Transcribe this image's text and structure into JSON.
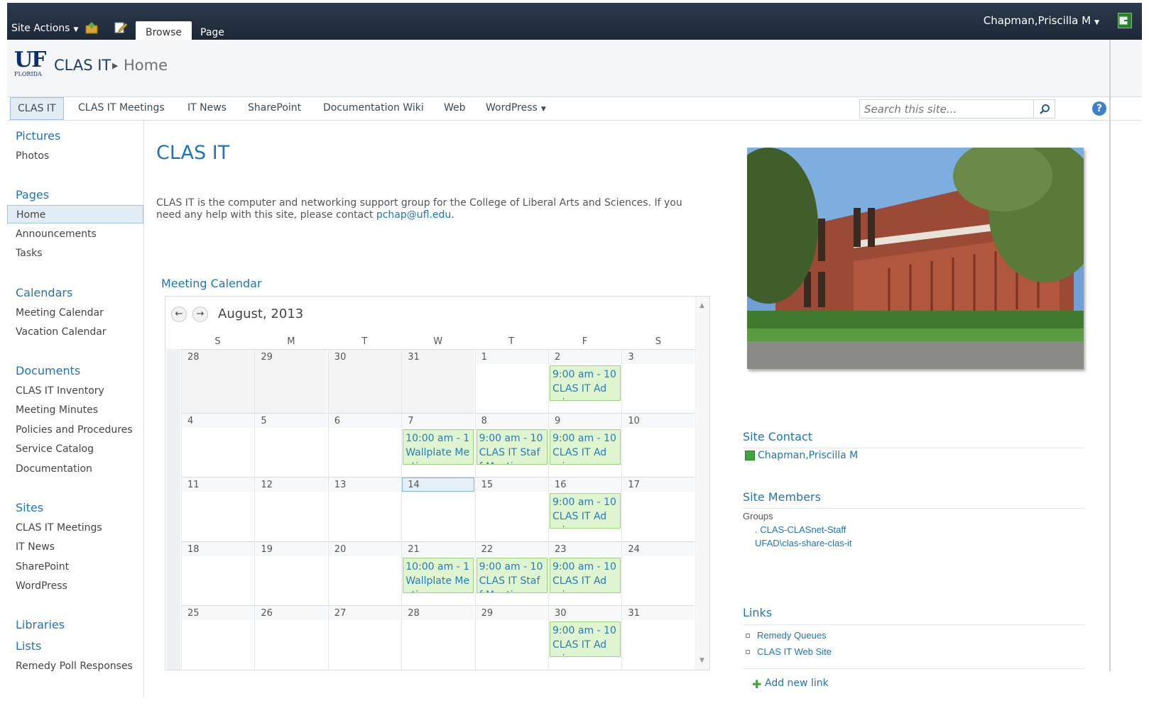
{
  "ribbon": {
    "site_actions": "Site Actions",
    "tabs": [
      "Browse",
      "Page"
    ],
    "user": "Chapman,Priscilla M"
  },
  "title": {
    "logo_top": "UF",
    "logo_sub": "FLORIDA",
    "site": "CLAS IT",
    "page": "Home"
  },
  "topnav": {
    "items": [
      "CLAS IT",
      "CLAS IT Meetings",
      "IT News",
      "SharePoint",
      "Documentation Wiki",
      "Web",
      "WordPress"
    ],
    "search_placeholder": "Search this site...",
    "help": "?"
  },
  "leftnav": {
    "pictures": "Pictures",
    "photos": "Photos",
    "pages": "Pages",
    "pages_items": [
      "Home",
      "Announcements",
      "Tasks"
    ],
    "calendars": "Calendars",
    "calendar_items": [
      "Meeting Calendar",
      "Vacation Calendar"
    ],
    "documents": "Documents",
    "document_items": [
      "CLAS IT Inventory",
      "Meeting Minutes",
      "Policies and Procedures",
      "Service Catalog",
      "Documentation"
    ],
    "sites": "Sites",
    "site_items": [
      "CLAS IT Meetings",
      "IT News",
      "SharePoint",
      "WordPress"
    ],
    "libraries": "Libraries",
    "lists": "Lists",
    "remedy": "Remedy Poll Responses"
  },
  "main": {
    "title": "CLAS IT",
    "intro": "CLAS IT is the computer and networking support group for the College of Liberal Arts and Sciences. If you need any help with this site, please contact ",
    "email": "pchap@ufl.edu",
    "intro_end": "."
  },
  "calendar": {
    "title": "Meeting Calendar",
    "month": "August, 2013",
    "days_of_week": [
      "S",
      "M",
      "T",
      "W",
      "T",
      "F",
      "S"
    ],
    "weeks": [
      [
        {
          "d": "28",
          "other": true
        },
        {
          "d": "29",
          "other": true
        },
        {
          "d": "30",
          "other": true
        },
        {
          "d": "31",
          "other": true
        },
        {
          "d": "1"
        },
        {
          "d": "2",
          "ev": {
            "t": "9:00 am - 10",
            "n": "CLAS IT Ad",
            "n2": "mins"
          }
        },
        {
          "d": "3"
        }
      ],
      [
        {
          "d": "4"
        },
        {
          "d": "5"
        },
        {
          "d": "6"
        },
        {
          "d": "7",
          "ev": {
            "t": "10:00 am - 1",
            "n": "Wallplate Me",
            "n2": "eting"
          }
        },
        {
          "d": "8",
          "ev": {
            "t": "9:00 am - 10",
            "n": "CLAS IT Staf",
            "n2": "f Meeting"
          }
        },
        {
          "d": "9",
          "ev": {
            "t": "9:00 am - 10",
            "n": "CLAS IT Ad",
            "n2": "mins"
          }
        },
        {
          "d": "10"
        }
      ],
      [
        {
          "d": "11"
        },
        {
          "d": "12"
        },
        {
          "d": "13"
        },
        {
          "d": "14",
          "today": true
        },
        {
          "d": "15"
        },
        {
          "d": "16",
          "ev": {
            "t": "9:00 am - 10",
            "n": "CLAS IT Ad",
            "n2": "mins"
          }
        },
        {
          "d": "17"
        }
      ],
      [
        {
          "d": "18"
        },
        {
          "d": "19"
        },
        {
          "d": "20"
        },
        {
          "d": "21",
          "ev": {
            "t": "10:00 am - 1",
            "n": "Wallplate Me",
            "n2": "eting"
          }
        },
        {
          "d": "22",
          "ev": {
            "t": "9:00 am - 10",
            "n": "CLAS IT Staf",
            "n2": "f Meeting"
          }
        },
        {
          "d": "23",
          "ev": {
            "t": "9:00 am - 10",
            "n": "CLAS IT Ad",
            "n2": "mins"
          }
        },
        {
          "d": "24"
        }
      ],
      [
        {
          "d": "25"
        },
        {
          "d": "26"
        },
        {
          "d": "27"
        },
        {
          "d": "28"
        },
        {
          "d": "29"
        },
        {
          "d": "30",
          "ev": {
            "t": "9:00 am - 10",
            "n": "CLAS IT Ad",
            "n2": "mins"
          }
        },
        {
          "d": "31"
        }
      ]
    ]
  },
  "right": {
    "site_contact": "Site Contact",
    "contact_name": "Chapman,Priscilla M",
    "site_members": "Site Members",
    "groups_label": "Groups",
    "groups": [
      ". CLAS-CLASnet-Staff",
      "UFAD\\clas-share-clas-it"
    ],
    "links_title": "Links",
    "links": [
      "Remedy Queues",
      "CLAS IT Web Site"
    ],
    "add_link": "Add new link"
  },
  "colors": {
    "ribbon": "#1d2837",
    "accent": "#1f74b9",
    "event_bg": "#dff5d0"
  }
}
